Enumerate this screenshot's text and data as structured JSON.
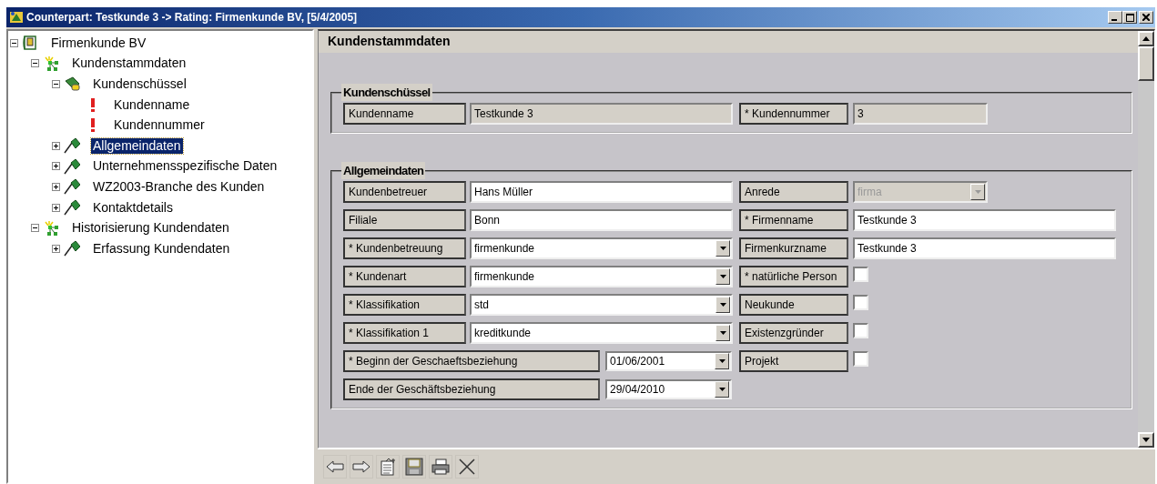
{
  "window": {
    "title": "Counterpart: Testkunde 3 -> Rating: Firmenkunde BV, [5/4/2005]"
  },
  "tree": [
    {
      "label": "Firmenkunde BV",
      "kind": "root",
      "expanded": true,
      "selected": false,
      "children": [
        {
          "label": "Kundenstammdaten",
          "kind": "group",
          "expanded": true,
          "selected": false,
          "children": [
            {
              "label": "Kundenschüssel",
              "kind": "key",
              "expanded": true,
              "selected": false,
              "children": [
                {
                  "label": "Kundenname",
                  "kind": "field",
                  "selected": false
                },
                {
                  "label": "Kundennummer",
                  "kind": "field",
                  "selected": false
                }
              ]
            },
            {
              "label": "Allgemeindaten",
              "kind": "section",
              "expanded": false,
              "selected": true
            },
            {
              "label": "Unternehmensspezifische Daten",
              "kind": "section",
              "expanded": false,
              "selected": false
            },
            {
              "label": "WZ2003-Branche des Kunden",
              "kind": "section",
              "expanded": false,
              "selected": false
            },
            {
              "label": "Kontaktdetails",
              "kind": "section",
              "expanded": false,
              "selected": false
            }
          ]
        },
        {
          "label": "Historisierung Kundendaten",
          "kind": "group",
          "expanded": true,
          "selected": false,
          "children": [
            {
              "label": "Erfassung Kundendaten",
              "kind": "section",
              "expanded": false,
              "selected": false
            }
          ]
        }
      ]
    }
  ],
  "pane": {
    "title": "Kundenstammdaten",
    "groups": [
      {
        "title": "Kundenschüssel",
        "columns": [
          [
            {
              "label": "Kundenname",
              "kind": "readonly",
              "value": "Testkunde 3"
            }
          ],
          [
            {
              "label": "* Kundennummer",
              "kind": "readonly",
              "value": "3"
            }
          ]
        ]
      },
      {
        "title": "Allgemeindaten",
        "columns": [
          [
            {
              "label": "Kundenbetreuer",
              "kind": "text",
              "value": "Hans Müller"
            },
            {
              "label": "Filiale",
              "kind": "text",
              "value": "Bonn"
            },
            {
              "label": "* Kundenbetreuung",
              "kind": "select",
              "value": "firmenkunde",
              "disabled": false
            },
            {
              "label": "* Kundenart",
              "kind": "select",
              "value": "firmenkunde",
              "disabled": false
            },
            {
              "label": "* Klassifikation",
              "kind": "select",
              "value": "std",
              "disabled": false
            },
            {
              "label": "* Klassifikation 1",
              "kind": "select",
              "value": "kreditkunde",
              "disabled": false
            },
            {
              "label": "* Beginn der Geschaeftsbeziehung",
              "kind": "date",
              "value": "01/06/2001"
            },
            {
              "label": "Ende der Geschäftsbeziehung",
              "kind": "date",
              "value": "29/04/2010"
            }
          ],
          [
            {
              "label": "Anrede",
              "kind": "select",
              "value": "firma",
              "disabled": true
            },
            {
              "label": "* Firmenname",
              "kind": "text",
              "value": "Testkunde 3"
            },
            {
              "label": "Firmenkurzname",
              "kind": "text",
              "value": "Testkunde 3"
            },
            {
              "label": "* natürliche Person",
              "kind": "checkbox",
              "checked": false
            },
            {
              "label": "Neukunde",
              "kind": "checkbox",
              "checked": false
            },
            {
              "label": "Existenzgründer",
              "kind": "checkbox",
              "checked": false
            },
            {
              "label": "Projekt",
              "kind": "checkbox",
              "checked": false
            }
          ]
        ]
      }
    ]
  }
}
